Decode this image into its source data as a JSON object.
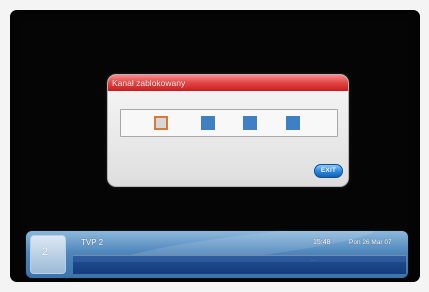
{
  "dialog": {
    "title": "Kanał zablokowany",
    "exit_label": "EXIT"
  },
  "pin": {
    "digits_total": 4,
    "active_index": 0
  },
  "infobar": {
    "channel_number": "2",
    "channel_name": "TVP 2",
    "time": "15:48",
    "date": "Pon 26 Mar 07",
    "epg_text": "..."
  },
  "colors": {
    "background": "#050505",
    "dialog_title": "#d83434",
    "pin_active_border": "#d67a39",
    "pin_filled": "#3f7fc3",
    "exit_button": "#2b8be2",
    "infobar": "#4f87bd"
  }
}
